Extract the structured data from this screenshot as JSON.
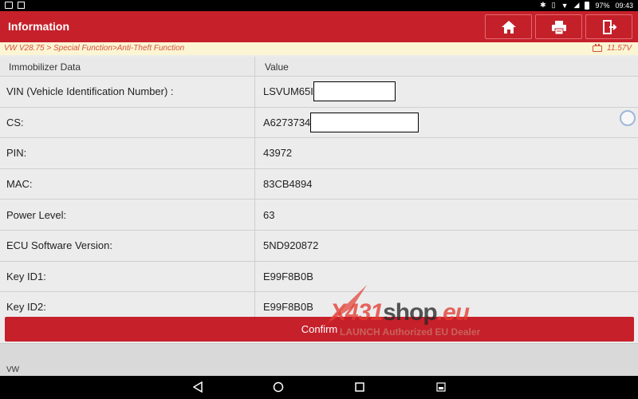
{
  "status_bar": {
    "battery": "97%",
    "time": "09:43",
    "left_icons": [
      "gallery-icon",
      "settings-icon"
    ],
    "right_icons": [
      "bluetooth-icon",
      "vibrate-icon",
      "wifi-icon",
      "no-signal-icon",
      "battery-icon"
    ]
  },
  "header": {
    "title": "Information",
    "buttons": [
      "home-icon",
      "print-icon",
      "exit-icon"
    ]
  },
  "breadcrumb": {
    "path": "VW V28.75 > Special Function>Anti-Theft Function",
    "voltage": "11.57V"
  },
  "table": {
    "headers": [
      "Immobilizer Data",
      "Value"
    ],
    "rows": [
      {
        "label": "VIN (Vehicle Identification Number) :",
        "value": "LSVUM65I",
        "redacted": true
      },
      {
        "label": "CS:",
        "value": "A6273734",
        "redacted": true
      },
      {
        "label": "PIN:",
        "value": "43972"
      },
      {
        "label": "MAC:",
        "value": "83CB4894"
      },
      {
        "label": "Power Level:",
        "value": "63"
      },
      {
        "label": "ECU Software Version:",
        "value": "5ND920872"
      },
      {
        "label": "Key ID1:",
        "value": "E99F8B0B"
      },
      {
        "label": "Key ID2:",
        "value": "E99F8B0B"
      }
    ]
  },
  "confirm_label": "Confirm",
  "watermark": {
    "brand_main": "X431",
    "brand_shop": "shop",
    "brand_tld": ".eu",
    "tagline": "LAUNCH Authorized EU Dealer"
  },
  "footer": {
    "text": "VW"
  },
  "nav_icons": [
    "back-icon",
    "home-nav-icon",
    "recents-icon",
    "screenshot-icon"
  ],
  "colors": {
    "accent": "#c6202b",
    "breadcrumb_bg": "#fbf5d4",
    "breadcrumb_text": "#d6513a"
  }
}
